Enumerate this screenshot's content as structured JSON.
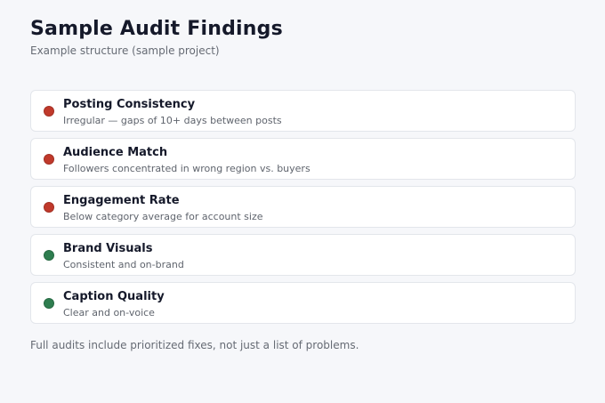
{
  "header": {
    "title": "Sample Audit Findings",
    "subtitle": "Example structure (sample project)"
  },
  "findings": [
    {
      "title": "Posting Consistency",
      "description": "Irregular — gaps of 10+ days between posts",
      "status": "issue",
      "status_color": "#c0392b"
    },
    {
      "title": "Audience Match",
      "description": "Followers concentrated in wrong region vs. buyers",
      "status": "issue",
      "status_color": "#c0392b"
    },
    {
      "title": "Engagement Rate",
      "description": "Below category average for account size",
      "status": "issue",
      "status_color": "#c0392b"
    },
    {
      "title": "Brand Visuals",
      "description": "Consistent and on-brand",
      "status": "ok",
      "status_color": "#2e7d4f"
    },
    {
      "title": "Caption Quality",
      "description": "Clear and on-voice",
      "status": "ok",
      "status_color": "#2e7d4f"
    }
  ],
  "footer": {
    "note": "Full audits include prioritized fixes, not just a list of problems."
  }
}
